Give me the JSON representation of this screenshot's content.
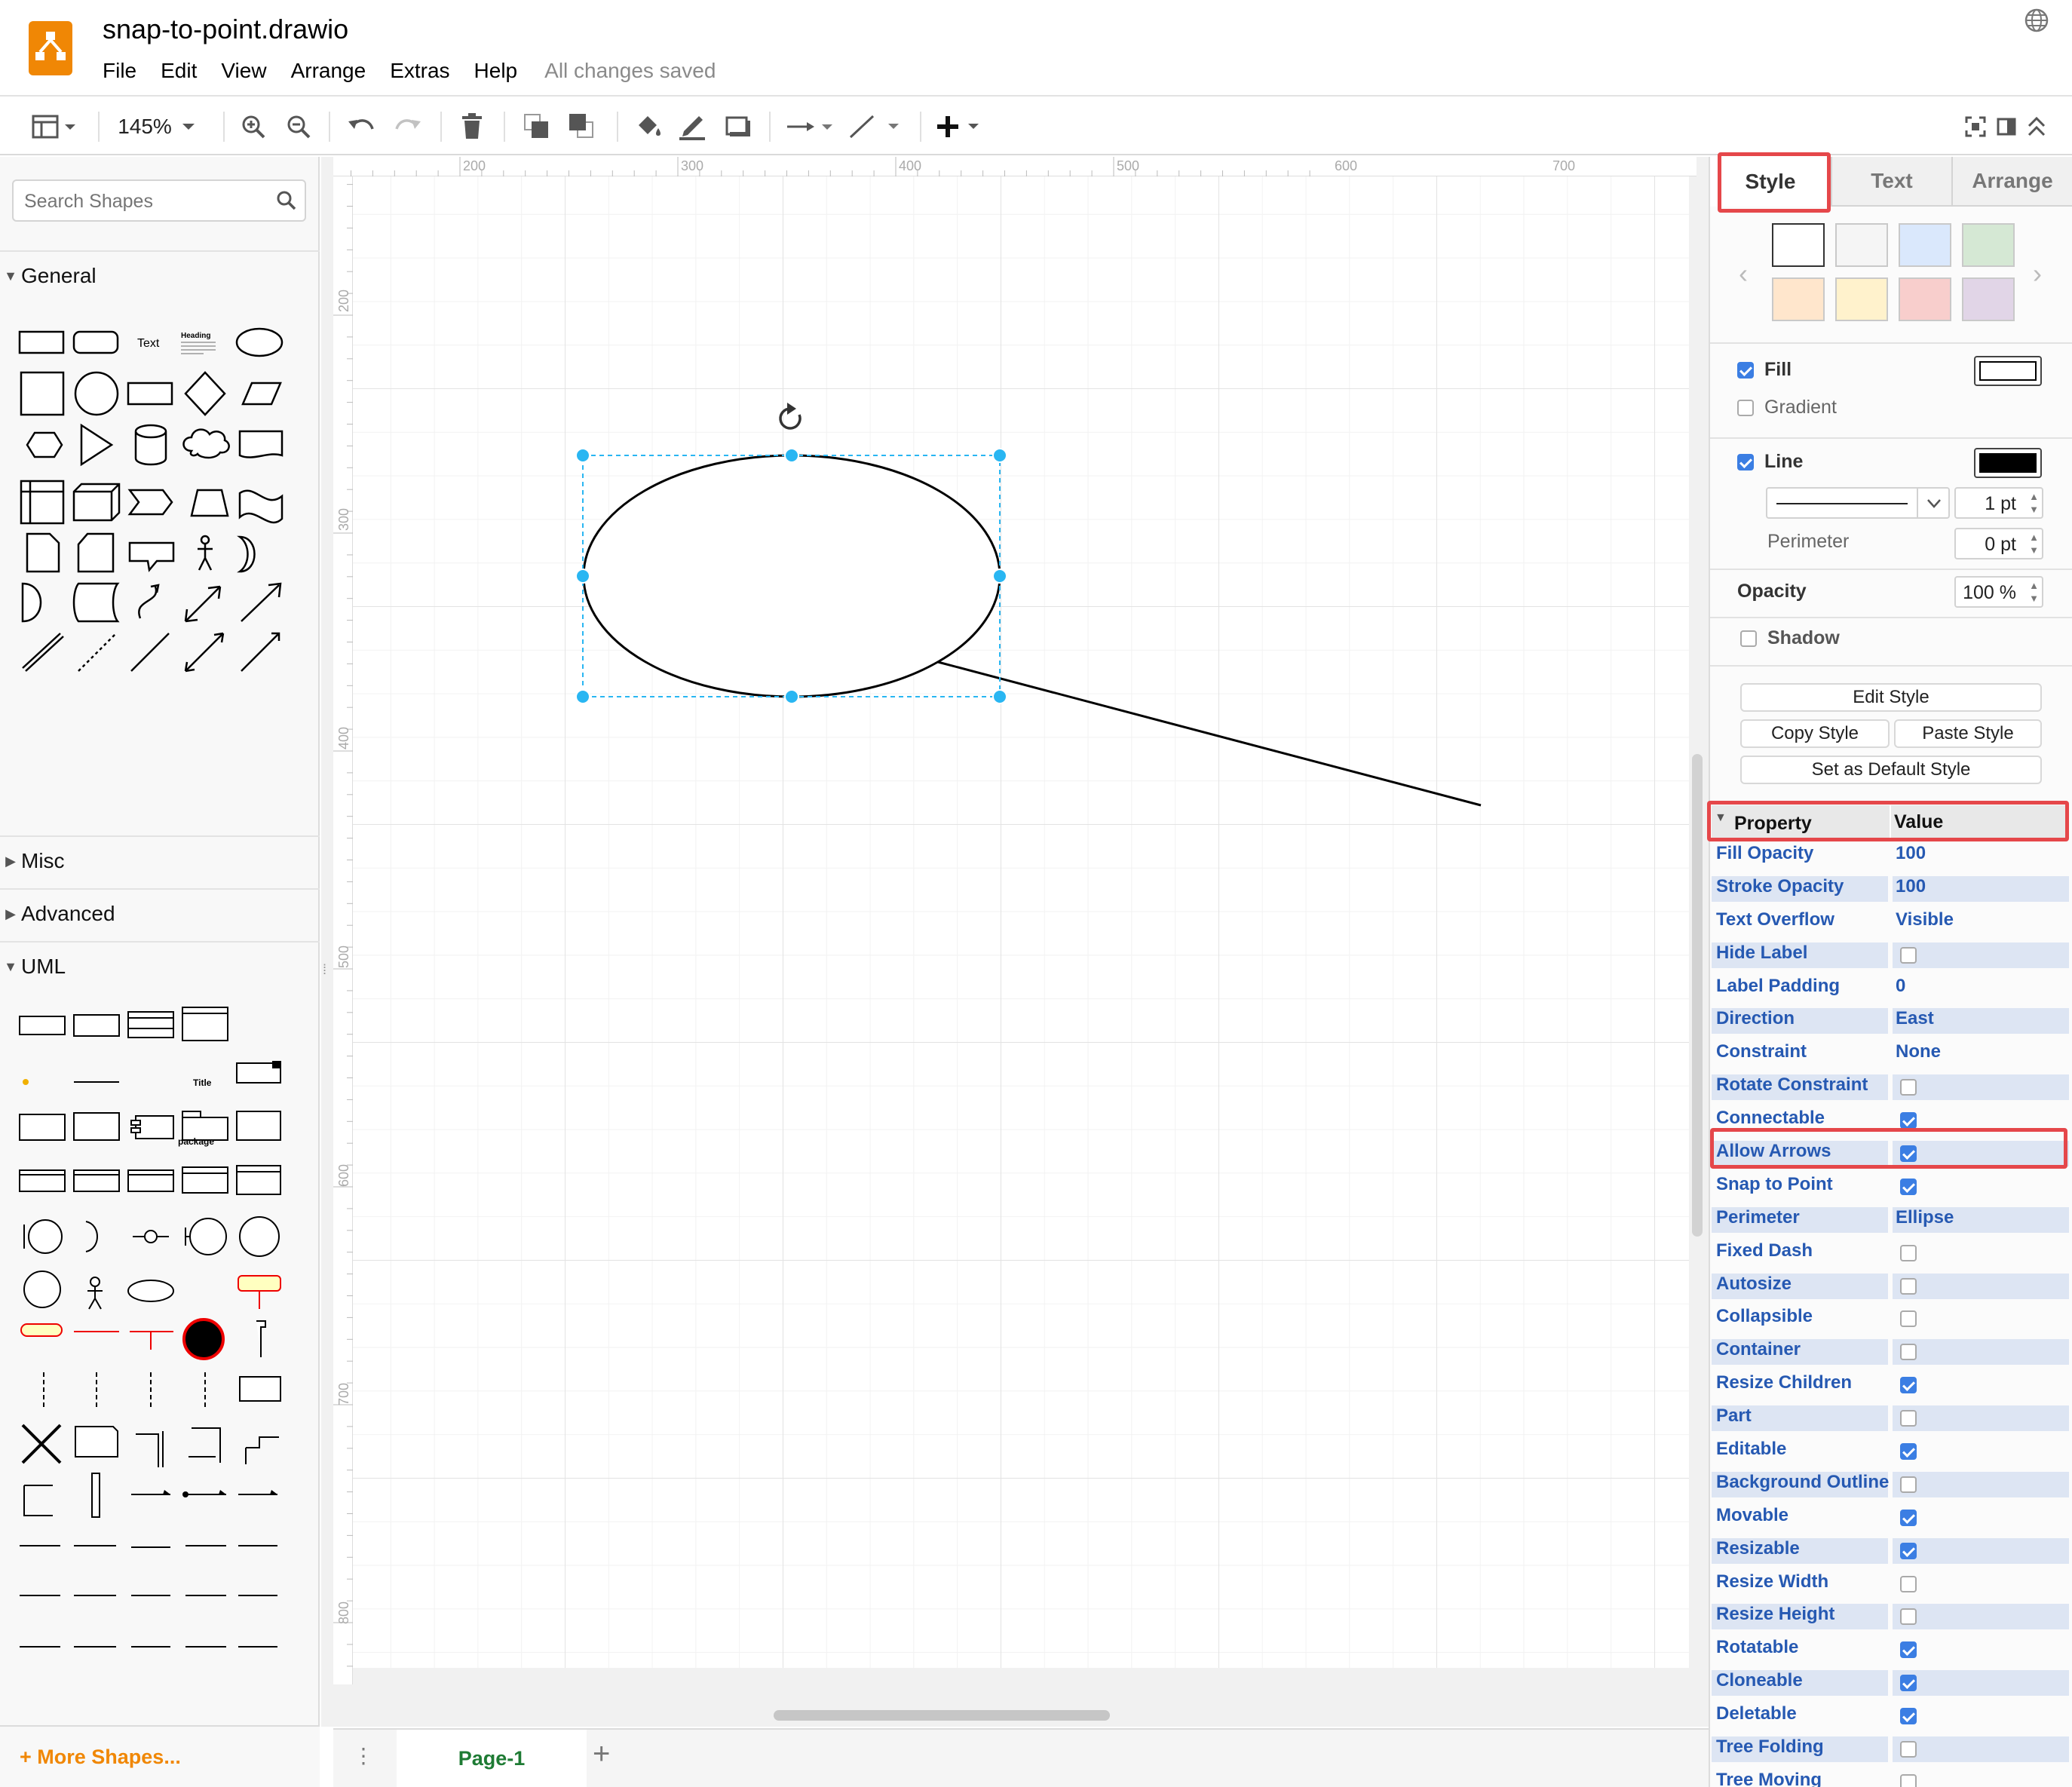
{
  "app": {
    "document_title": "snap-to-point.drawio",
    "save_status": "All changes saved",
    "menu": [
      "File",
      "Edit",
      "View",
      "Arrange",
      "Extras",
      "Help"
    ]
  },
  "toolbar": {
    "zoom": "145%",
    "icons": [
      "format-panel-icon",
      "zoom-in-icon",
      "zoom-out-icon",
      "undo-icon",
      "redo-icon",
      "delete-icon",
      "to-front-icon",
      "to-back-icon",
      "fill-color-icon",
      "line-color-icon",
      "shadow-icon",
      "connection-icon",
      "waypoints-icon",
      "insert-icon",
      "fullscreen-icon",
      "format-toggle-icon",
      "collapse-icon"
    ]
  },
  "shapes_panel": {
    "search_placeholder": "Search Shapes",
    "sections": {
      "general": "General",
      "misc": "Misc",
      "advanced": "Advanced",
      "uml": "UML"
    },
    "general_text_shape": "Text",
    "general_heading_shape": "Heading",
    "more_shapes": "+ More Shapes..."
  },
  "canvas": {
    "ruler_top": [
      "200",
      "300",
      "400",
      "500",
      "600",
      "700"
    ],
    "ruler_left": [
      "200",
      "300",
      "400",
      "500",
      "600",
      "700",
      "800"
    ],
    "selected_shape": "ellipse",
    "accent_color": "#29b6f2"
  },
  "pages": {
    "current": "Page-1"
  },
  "format_panel": {
    "tabs": [
      "Style",
      "Text",
      "Arrange"
    ],
    "active_tab": "Style",
    "swatches": [
      "#ffffff",
      "#f5f5f5",
      "#dae8fc",
      "#d5e8d4",
      "#ffe6cc",
      "#fff2cc",
      "#f8cecc",
      "#e1d5e7"
    ],
    "fill": {
      "label": "Fill",
      "checked": true
    },
    "gradient": {
      "label": "Gradient",
      "checked": false
    },
    "line": {
      "label": "Line",
      "checked": true,
      "width": "1 pt"
    },
    "perimeter": {
      "label": "Perimeter",
      "value": "0 pt"
    },
    "opacity": {
      "label": "Opacity",
      "value": "100 %"
    },
    "shadow": {
      "label": "Shadow",
      "checked": false
    },
    "buttons": {
      "edit_style": "Edit Style",
      "copy_style": "Copy Style",
      "paste_style": "Paste Style",
      "set_default": "Set as Default Style"
    },
    "highlight_color": "#e5474a"
  },
  "properties": {
    "header": {
      "property": "Property",
      "value": "Value"
    },
    "rows": [
      {
        "name": "Fill Opacity",
        "value": "100"
      },
      {
        "name": "Stroke Opacity",
        "value": "100"
      },
      {
        "name": "Text Overflow",
        "value": "Visible"
      },
      {
        "name": "Hide Label",
        "checked": false
      },
      {
        "name": "Label Padding",
        "value": "0"
      },
      {
        "name": "Direction",
        "value": "East"
      },
      {
        "name": "Constraint",
        "value": "None"
      },
      {
        "name": "Rotate Constraint",
        "checked": false
      },
      {
        "name": "Connectable",
        "checked": true
      },
      {
        "name": "Allow Arrows",
        "checked": true
      },
      {
        "name": "Snap to Point",
        "checked": true
      },
      {
        "name": "Perimeter",
        "value": "Ellipse"
      },
      {
        "name": "Fixed Dash",
        "checked": false
      },
      {
        "name": "Autosize",
        "checked": false
      },
      {
        "name": "Collapsible",
        "checked": false
      },
      {
        "name": "Container",
        "checked": false
      },
      {
        "name": "Resize Children",
        "checked": true
      },
      {
        "name": "Part",
        "checked": false
      },
      {
        "name": "Editable",
        "checked": true
      },
      {
        "name": "Background Outline",
        "checked": false
      },
      {
        "name": "Movable",
        "checked": true
      },
      {
        "name": "Resizable",
        "checked": true
      },
      {
        "name": "Resize Width",
        "checked": false
      },
      {
        "name": "Resize Height",
        "checked": false
      },
      {
        "name": "Rotatable",
        "checked": true
      },
      {
        "name": "Cloneable",
        "checked": true
      },
      {
        "name": "Deletable",
        "checked": true
      },
      {
        "name": "Tree Folding",
        "checked": false
      },
      {
        "name": "Tree Moving",
        "checked": false
      }
    ]
  }
}
